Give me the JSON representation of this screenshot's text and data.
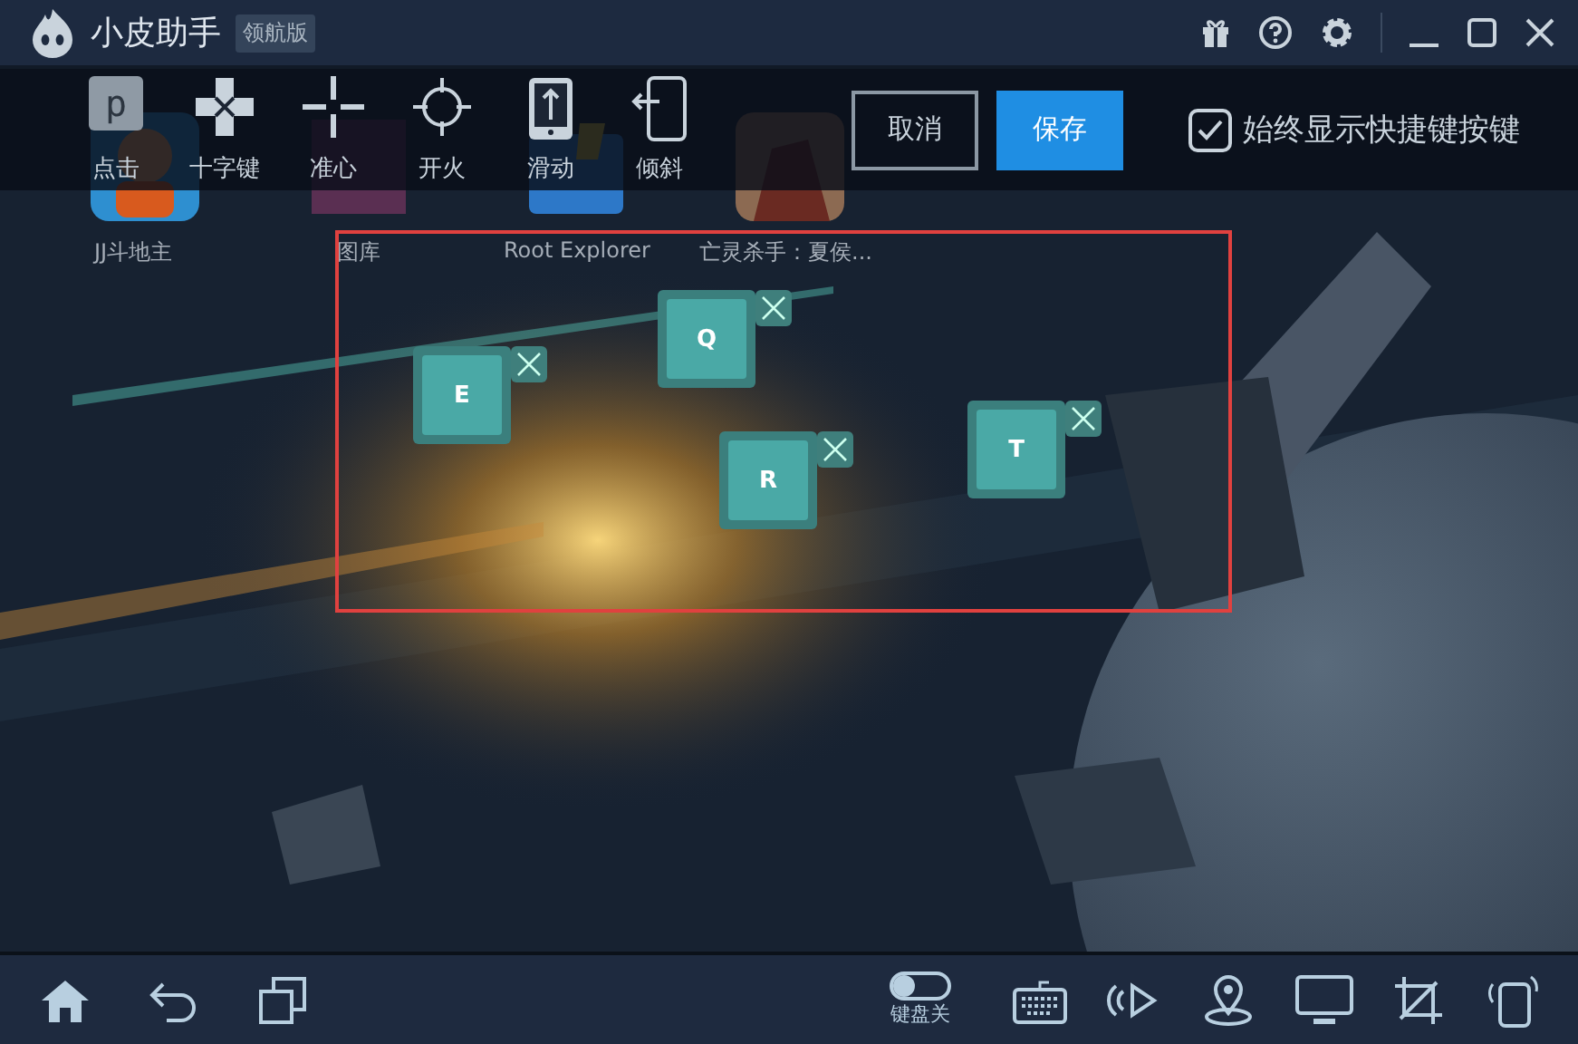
{
  "window": {
    "title": "小皮助手",
    "edition": "领航版"
  },
  "toolbar": {
    "tools": [
      {
        "label": "点击",
        "kind": "tap",
        "key": "p"
      },
      {
        "label": "十字键",
        "kind": "dpad"
      },
      {
        "label": "准心",
        "kind": "aim"
      },
      {
        "label": "开火",
        "kind": "fire"
      },
      {
        "label": "滑动",
        "kind": "swipe"
      },
      {
        "label": "倾斜",
        "kind": "tilt"
      }
    ],
    "buttons": [
      {
        "label": "取消",
        "kind": "cancel"
      },
      {
        "label": "保存",
        "kind": "save"
      }
    ],
    "always_show": {
      "label": "始终显示快捷键按键",
      "checked": true
    }
  },
  "apps": [
    {
      "label": "JJ斗地主"
    },
    {
      "label": "图库"
    },
    {
      "label": "Root Explorer"
    },
    {
      "label": "亡灵杀手：夏侯..."
    }
  ],
  "keys": [
    {
      "label": "E"
    },
    {
      "label": "Q"
    },
    {
      "label": "R"
    },
    {
      "label": "T"
    }
  ],
  "bottom_bar": {
    "keyboard_toggle": {
      "label": "键盘关",
      "on": false
    }
  }
}
